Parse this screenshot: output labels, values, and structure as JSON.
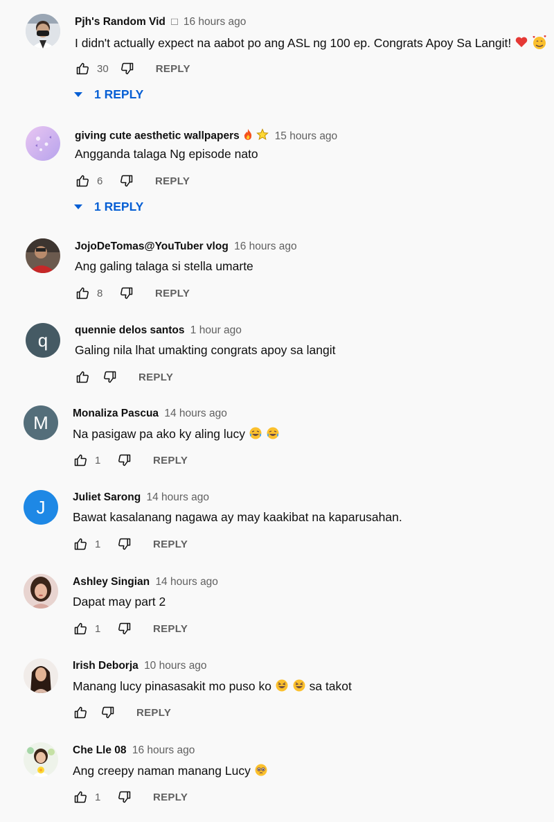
{
  "reply_label": "REPLY",
  "comments": [
    {
      "author": "Pjh's Random Vid",
      "badge": "□",
      "time": "16 hours ago",
      "text": "I didn't actually expect na aabot po ang ASL ng 100 ep. Congrats Apoy Sa Langit!",
      "likes": "30",
      "replies": "1 REPLY",
      "avatar": {
        "type": "photo",
        "icon": "person-mask-avatar"
      }
    },
    {
      "author": "giving cute aesthetic wallpapers",
      "time": "15 hours ago",
      "text": "Angganda talaga Ng episode nato",
      "likes": "6",
      "replies": "1 REPLY",
      "avatar": {
        "type": "photo",
        "icon": "pastel-butterfly-avatar"
      }
    },
    {
      "author": "JojoDeTomas@YouTuber vlog",
      "time": "16 hours ago",
      "text": "Ang galing talaga si stella umarte",
      "likes": "8",
      "avatar": {
        "type": "photo",
        "icon": "person-red-shirt-avatar"
      }
    },
    {
      "author": "quennie delos santos",
      "time": "1 hour ago",
      "text": "Galing nila lhat umakting congrats apoy sa langit",
      "likes": "",
      "avatar": {
        "type": "letter",
        "letter": "q",
        "color": "#455a64"
      }
    },
    {
      "author": "Monaliza Pascua",
      "time": "14 hours ago",
      "text": "Na pasigaw pa ako ky aling lucy",
      "likes": "1",
      "avatar": {
        "type": "letter",
        "letter": "M",
        "color": "#546e7a"
      }
    },
    {
      "author": "Juliet Sarong",
      "time": "14 hours ago",
      "text": "Bawat kasalanang nagawa ay may kaakibat na kaparusahan.",
      "likes": "1",
      "avatar": {
        "type": "letter",
        "letter": "J",
        "color": "#1e88e5"
      }
    },
    {
      "author": "Ashley Singian",
      "time": "14 hours ago",
      "text": "Dapat may part 2",
      "likes": "1",
      "avatar": {
        "type": "photo",
        "icon": "girl-portrait-avatar"
      }
    },
    {
      "author": "Irish Deborja",
      "time": "10 hours ago",
      "text": "Manang lucy pinasasakit mo puso ko",
      "text_after": "sa takot",
      "likes": "",
      "avatar": {
        "type": "photo",
        "icon": "girl-long-hair-avatar"
      }
    },
    {
      "author": "Che Lle 08",
      "time": "16 hours ago",
      "text": "Ang creepy naman manang Lucy",
      "likes": "1",
      "avatar": {
        "type": "photo",
        "icon": "girl-yellow-flower-avatar"
      }
    }
  ]
}
